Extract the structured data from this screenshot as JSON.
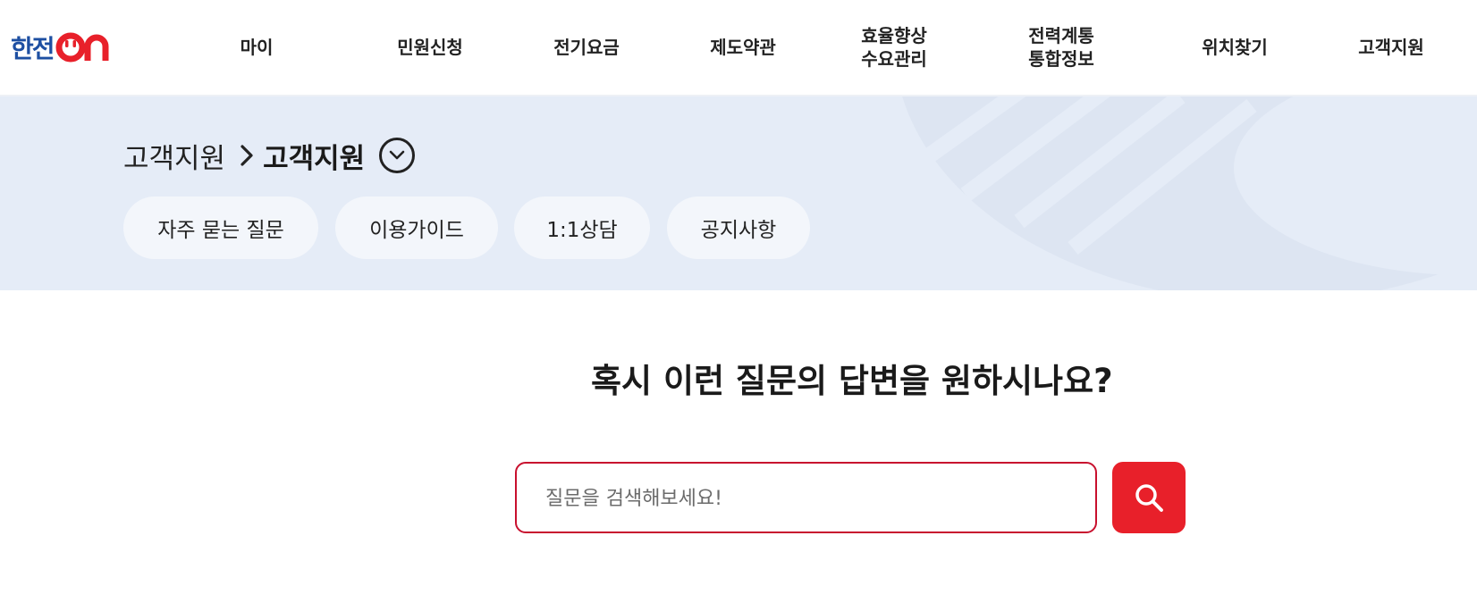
{
  "brand": {
    "logo_text": "한전",
    "logo_suffix": "ON",
    "colors": {
      "blue": "#1d4fa2",
      "red": "#e8202a"
    }
  },
  "nav": {
    "items": [
      {
        "label": "마이"
      },
      {
        "label": "민원신청"
      },
      {
        "label": "전기요금"
      },
      {
        "label": "제도약관"
      },
      {
        "label_line1": "효율향상",
        "label_line2": "수요관리"
      },
      {
        "label_line1": "전력계통",
        "label_line2": "통합정보"
      },
      {
        "label": "위치찾기"
      },
      {
        "label": "고객지원"
      }
    ]
  },
  "breadcrumb": {
    "root": "고객지원",
    "current": "고객지원",
    "separator_icon": "chevron-right-icon",
    "toggle_icon": "chevron-down-circle-icon"
  },
  "tabs": [
    {
      "label": "자주 묻는 질문"
    },
    {
      "label": "이용가이드"
    },
    {
      "label": "1:1상담"
    },
    {
      "label": "공지사항"
    }
  ],
  "main": {
    "question": "혹시 이런 질문의 답변을 원하시나요?",
    "search": {
      "placeholder": "질문을 검색해보세요!",
      "value": "",
      "button_icon": "search-icon"
    }
  },
  "colors": {
    "banner_bg": "#e5ecf7",
    "pill_bg": "#f3f6fb",
    "search_border": "#c8102e",
    "search_button": "#e8202a"
  }
}
